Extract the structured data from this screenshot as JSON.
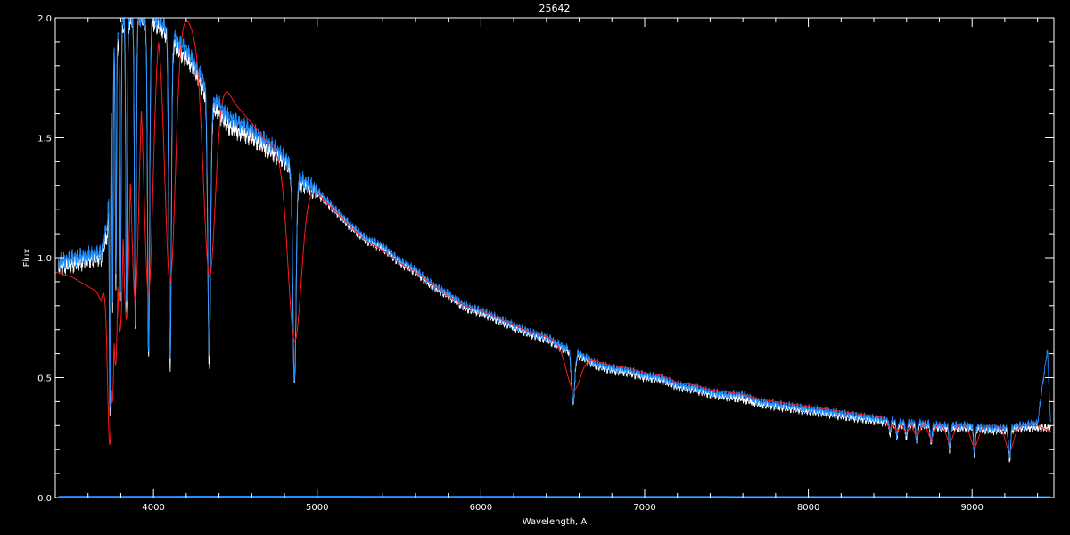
{
  "chart_data": {
    "type": "line",
    "title": "25642",
    "xlabel": "Wavelength, A",
    "ylabel": "Flux",
    "xlim": [
      3400,
      9500
    ],
    "ylim": [
      0.0,
      2.0
    ],
    "x_ticks": [
      4000,
      5000,
      6000,
      7000,
      8000,
      9000
    ],
    "x_tick_labels": [
      "4000",
      "5000",
      "6000",
      "7000",
      "8000",
      "9000"
    ],
    "y_ticks": [
      0.0,
      0.5,
      1.0,
      1.5,
      2.0
    ],
    "y_tick_labels": [
      "0.0",
      "0.5",
      "1.0",
      "1.5",
      "2.0"
    ],
    "grid": false,
    "background": "#000000",
    "axis_color": "#ffffff",
    "series": [
      {
        "color": "#ffffff",
        "role": "observed",
        "points": [
          [
            3420,
            0.96
          ],
          [
            3500,
            0.97
          ],
          [
            3600,
            0.99
          ],
          [
            3680,
            1.0
          ],
          [
            3720,
            1.1
          ],
          [
            3750,
            1.8
          ],
          [
            3800,
            1.95
          ],
          [
            3900,
            2.0
          ],
          [
            4000,
            1.98
          ],
          [
            4100,
            1.92
          ],
          [
            4150,
            1.86
          ],
          [
            4200,
            1.83
          ],
          [
            4250,
            1.78
          ],
          [
            4300,
            1.7
          ],
          [
            4360,
            1.62
          ],
          [
            4400,
            1.6
          ],
          [
            4450,
            1.55
          ],
          [
            4500,
            1.53
          ],
          [
            4600,
            1.5
          ],
          [
            4700,
            1.45
          ],
          [
            4800,
            1.4
          ],
          [
            4900,
            1.31
          ],
          [
            5000,
            1.27
          ],
          [
            5100,
            1.2
          ],
          [
            5200,
            1.13
          ],
          [
            5300,
            1.07
          ],
          [
            5400,
            1.04
          ],
          [
            5500,
            0.98
          ],
          [
            5600,
            0.94
          ],
          [
            5700,
            0.88
          ],
          [
            5800,
            0.84
          ],
          [
            5900,
            0.79
          ],
          [
            6000,
            0.77
          ],
          [
            6100,
            0.74
          ],
          [
            6200,
            0.71
          ],
          [
            6300,
            0.68
          ],
          [
            6400,
            0.66
          ],
          [
            6500,
            0.62
          ],
          [
            6540,
            0.61
          ],
          [
            6600,
            0.59
          ],
          [
            6700,
            0.55
          ],
          [
            6800,
            0.53
          ],
          [
            6900,
            0.52
          ],
          [
            7000,
            0.5
          ],
          [
            7100,
            0.49
          ],
          [
            7200,
            0.46
          ],
          [
            7300,
            0.45
          ],
          [
            7400,
            0.43
          ],
          [
            7500,
            0.42
          ],
          [
            7600,
            0.41
          ],
          [
            7700,
            0.39
          ],
          [
            7800,
            0.38
          ],
          [
            7900,
            0.37
          ],
          [
            8000,
            0.36
          ],
          [
            8100,
            0.35
          ],
          [
            8200,
            0.34
          ],
          [
            8300,
            0.33
          ],
          [
            8400,
            0.32
          ],
          [
            8500,
            0.31
          ],
          [
            8600,
            0.3
          ],
          [
            8700,
            0.3
          ],
          [
            8800,
            0.29
          ],
          [
            8900,
            0.29
          ],
          [
            9000,
            0.29
          ],
          [
            9100,
            0.28
          ],
          [
            9200,
            0.28
          ],
          [
            9300,
            0.29
          ],
          [
            9400,
            0.29
          ],
          [
            9480,
            0.29
          ]
        ]
      },
      {
        "color": "#1e8cff",
        "role": "observed",
        "points": [
          [
            3420,
            0.98
          ],
          [
            3500,
            1.0
          ],
          [
            3600,
            1.01
          ],
          [
            3680,
            1.02
          ],
          [
            3720,
            1.15
          ],
          [
            3750,
            1.85
          ],
          [
            3800,
            2.0
          ],
          [
            3900,
            2.0
          ],
          [
            4000,
            2.0
          ],
          [
            4100,
            1.95
          ],
          [
            4150,
            1.9
          ],
          [
            4200,
            1.87
          ],
          [
            4250,
            1.81
          ],
          [
            4300,
            1.74
          ],
          [
            4360,
            1.66
          ],
          [
            4400,
            1.64
          ],
          [
            4450,
            1.59
          ],
          [
            4500,
            1.57
          ],
          [
            4600,
            1.53
          ],
          [
            4700,
            1.48
          ],
          [
            4800,
            1.42
          ],
          [
            4900,
            1.33
          ],
          [
            5000,
            1.28
          ],
          [
            5100,
            1.21
          ],
          [
            5200,
            1.14
          ],
          [
            5300,
            1.08
          ],
          [
            5400,
            1.05
          ],
          [
            5500,
            0.99
          ],
          [
            5600,
            0.95
          ],
          [
            5700,
            0.89
          ],
          [
            5800,
            0.85
          ],
          [
            5900,
            0.8
          ],
          [
            6000,
            0.78
          ],
          [
            6100,
            0.75
          ],
          [
            6200,
            0.72
          ],
          [
            6300,
            0.69
          ],
          [
            6400,
            0.67
          ],
          [
            6500,
            0.63
          ],
          [
            6540,
            0.62
          ],
          [
            6600,
            0.6
          ],
          [
            6700,
            0.56
          ],
          [
            6800,
            0.54
          ],
          [
            6900,
            0.53
          ],
          [
            7000,
            0.51
          ],
          [
            7100,
            0.5
          ],
          [
            7200,
            0.47
          ],
          [
            7300,
            0.46
          ],
          [
            7400,
            0.44
          ],
          [
            7500,
            0.43
          ],
          [
            7600,
            0.43
          ],
          [
            7700,
            0.4
          ],
          [
            7800,
            0.39
          ],
          [
            7900,
            0.38
          ],
          [
            8000,
            0.37
          ],
          [
            8100,
            0.36
          ],
          [
            8200,
            0.35
          ],
          [
            8300,
            0.34
          ],
          [
            8400,
            0.33
          ],
          [
            8500,
            0.32
          ],
          [
            8600,
            0.31
          ],
          [
            8700,
            0.31
          ],
          [
            8800,
            0.3
          ],
          [
            8900,
            0.3
          ],
          [
            9000,
            0.3
          ],
          [
            9100,
            0.29
          ],
          [
            9200,
            0.29
          ],
          [
            9300,
            0.3
          ],
          [
            9400,
            0.31
          ],
          [
            9460,
            0.62
          ],
          [
            9480,
            0.3
          ]
        ]
      },
      {
        "color": "#ff1a1a",
        "role": "model",
        "points": [
          [
            3400,
            0.94
          ],
          [
            3500,
            0.92
          ],
          [
            3600,
            0.88
          ],
          [
            3650,
            0.86
          ],
          [
            3680,
            0.82
          ],
          [
            3700,
            0.9
          ],
          [
            3750,
            1.2
          ],
          [
            3800,
            1.6
          ],
          [
            3900,
            1.9
          ],
          [
            4000,
            2.0
          ],
          [
            4100,
            2.0
          ],
          [
            4200,
            2.0
          ],
          [
            4250,
            1.94
          ],
          [
            4300,
            1.88
          ],
          [
            4340,
            1.8
          ],
          [
            4380,
            1.75
          ],
          [
            4450,
            1.7
          ],
          [
            4500,
            1.64
          ],
          [
            4600,
            1.56
          ],
          [
            4700,
            1.48
          ],
          [
            4800,
            1.42
          ],
          [
            4900,
            1.32
          ],
          [
            5000,
            1.27
          ],
          [
            5100,
            1.2
          ],
          [
            5200,
            1.13
          ],
          [
            5300,
            1.07
          ],
          [
            5400,
            1.03
          ],
          [
            5500,
            0.98
          ],
          [
            5600,
            0.94
          ],
          [
            5700,
            0.89
          ],
          [
            5800,
            0.84
          ],
          [
            5900,
            0.8
          ],
          [
            6000,
            0.78
          ],
          [
            6100,
            0.75
          ],
          [
            6200,
            0.72
          ],
          [
            6300,
            0.69
          ],
          [
            6400,
            0.67
          ],
          [
            6500,
            0.64
          ],
          [
            6540,
            0.63
          ],
          [
            6600,
            0.6
          ],
          [
            6700,
            0.57
          ],
          [
            6800,
            0.55
          ],
          [
            6900,
            0.54
          ],
          [
            7000,
            0.52
          ],
          [
            7100,
            0.51
          ],
          [
            7200,
            0.48
          ],
          [
            7300,
            0.47
          ],
          [
            7400,
            0.45
          ],
          [
            7500,
            0.44
          ],
          [
            7600,
            0.43
          ],
          [
            7700,
            0.41
          ],
          [
            7800,
            0.4
          ],
          [
            7900,
            0.39
          ],
          [
            8000,
            0.38
          ],
          [
            8100,
            0.37
          ],
          [
            8200,
            0.36
          ],
          [
            8300,
            0.35
          ],
          [
            8400,
            0.34
          ],
          [
            8500,
            0.33
          ],
          [
            8600,
            0.32
          ],
          [
            8700,
            0.31
          ],
          [
            8800,
            0.31
          ],
          [
            8900,
            0.3
          ],
          [
            9000,
            0.3
          ],
          [
            9100,
            0.3
          ],
          [
            9200,
            0.3
          ],
          [
            9300,
            0.3
          ],
          [
            9400,
            0.3
          ],
          [
            9500,
            0.27
          ]
        ]
      },
      {
        "color": "#1e8cff",
        "role": "error",
        "points": [
          [
            3420,
            0.006
          ],
          [
            9480,
            0.004
          ]
        ]
      }
    ],
    "absorption_lines": [
      {
        "x": 3734,
        "depth": 1.1,
        "width": 14
      },
      {
        "x": 3750,
        "depth": 1.0,
        "width": 12
      },
      {
        "x": 3770,
        "depth": 1.0,
        "width": 14
      },
      {
        "x": 3798,
        "depth": 1.1,
        "width": 16
      },
      {
        "x": 3835,
        "depth": 1.2,
        "width": 18
      },
      {
        "x": 3889,
        "depth": 1.3,
        "width": 22
      },
      {
        "x": 3970,
        "depth": 1.4,
        "width": 26
      },
      {
        "x": 4101,
        "depth": 1.38,
        "width": 30
      },
      {
        "x": 4340,
        "depth": 1.1,
        "width": 34
      },
      {
        "x": 4861,
        "depth": 0.88,
        "width": 38
      },
      {
        "x": 6563,
        "depth": 0.21,
        "width": 40
      },
      {
        "x": 8498,
        "depth": 0.05,
        "width": 18
      },
      {
        "x": 8542,
        "depth": 0.06,
        "width": 18
      },
      {
        "x": 8598,
        "depth": 0.06,
        "width": 18
      },
      {
        "x": 8662,
        "depth": 0.07,
        "width": 18
      },
      {
        "x": 8750,
        "depth": 0.08,
        "width": 18
      },
      {
        "x": 8863,
        "depth": 0.09,
        "width": 20
      },
      {
        "x": 9015,
        "depth": 0.11,
        "width": 22
      },
      {
        "x": 9229,
        "depth": 0.13,
        "width": 24
      }
    ]
  }
}
